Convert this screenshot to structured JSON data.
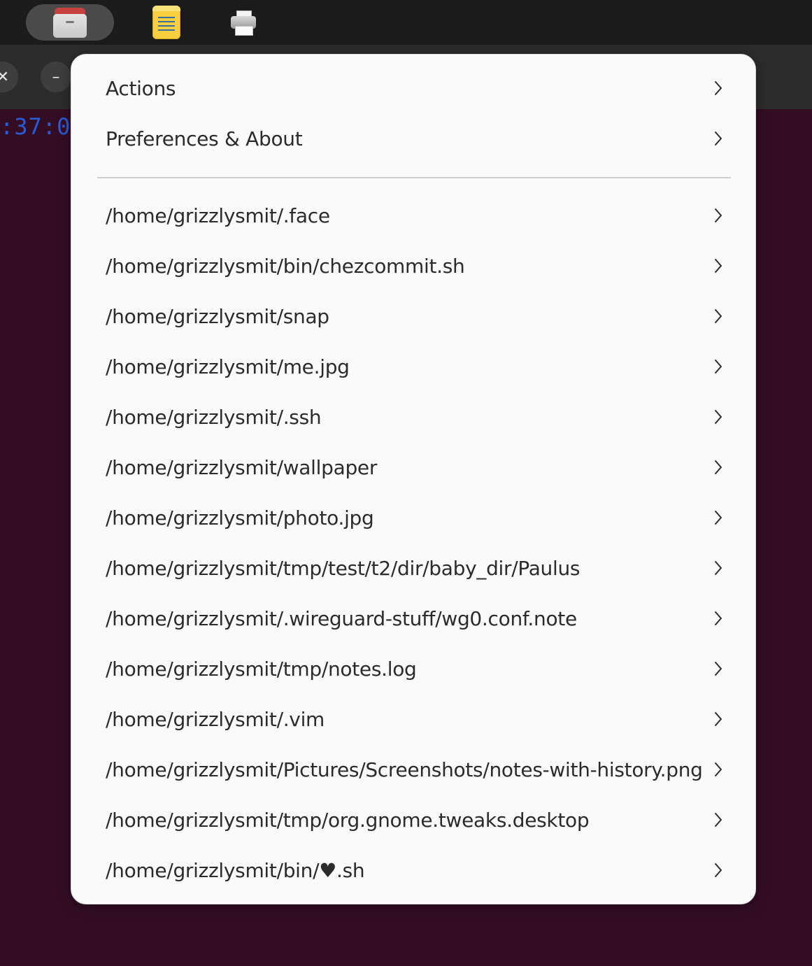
{
  "dock": {
    "apps": [
      {
        "name": "files",
        "icon": "files-icon",
        "active": true
      },
      {
        "name": "notes",
        "icon": "notes-icon",
        "active": false
      },
      {
        "name": "printer",
        "icon": "printer-icon",
        "active": false
      }
    ]
  },
  "window": {
    "close_glyph": "✕",
    "minimize_glyph": "–",
    "terminal_fragment": ":37:0"
  },
  "menu": {
    "sections": [
      {
        "label": "Actions",
        "icon": "chevron-right-icon"
      },
      {
        "label": "Preferences & About",
        "icon": "chevron-right-icon"
      }
    ],
    "recent": [
      {
        "label": "/home/grizzlysmit/.face"
      },
      {
        "label": "/home/grizzlysmit/bin/chezcommit.sh"
      },
      {
        "label": "/home/grizzlysmit/snap"
      },
      {
        "label": "/home/grizzlysmit/me.jpg"
      },
      {
        "label": "/home/grizzlysmit/.ssh"
      },
      {
        "label": "/home/grizzlysmit/wallpaper"
      },
      {
        "label": "/home/grizzlysmit/photo.jpg"
      },
      {
        "label": "/home/grizzlysmit/tmp/test/t2/dir/baby_dir/Paulus"
      },
      {
        "label": "/home/grizzlysmit/.wireguard-stuff/wg0.conf.note"
      },
      {
        "label": "/home/grizzlysmit/tmp/notes.log"
      },
      {
        "label": "/home/grizzlysmit/.vim"
      },
      {
        "label": "/home/grizzlysmit/Pictures/Screenshots/notes-with-history.png"
      },
      {
        "label": "/home/grizzlysmit/tmp/org.gnome.tweaks.desktop"
      },
      {
        "label": "/home/grizzlysmit/bin/♥.sh"
      }
    ]
  },
  "colors": {
    "desktop_bg": "#330d24",
    "popover_bg": "#fafafa",
    "text": "#2b2b2b",
    "terminal_text": "#2a5bd7"
  }
}
